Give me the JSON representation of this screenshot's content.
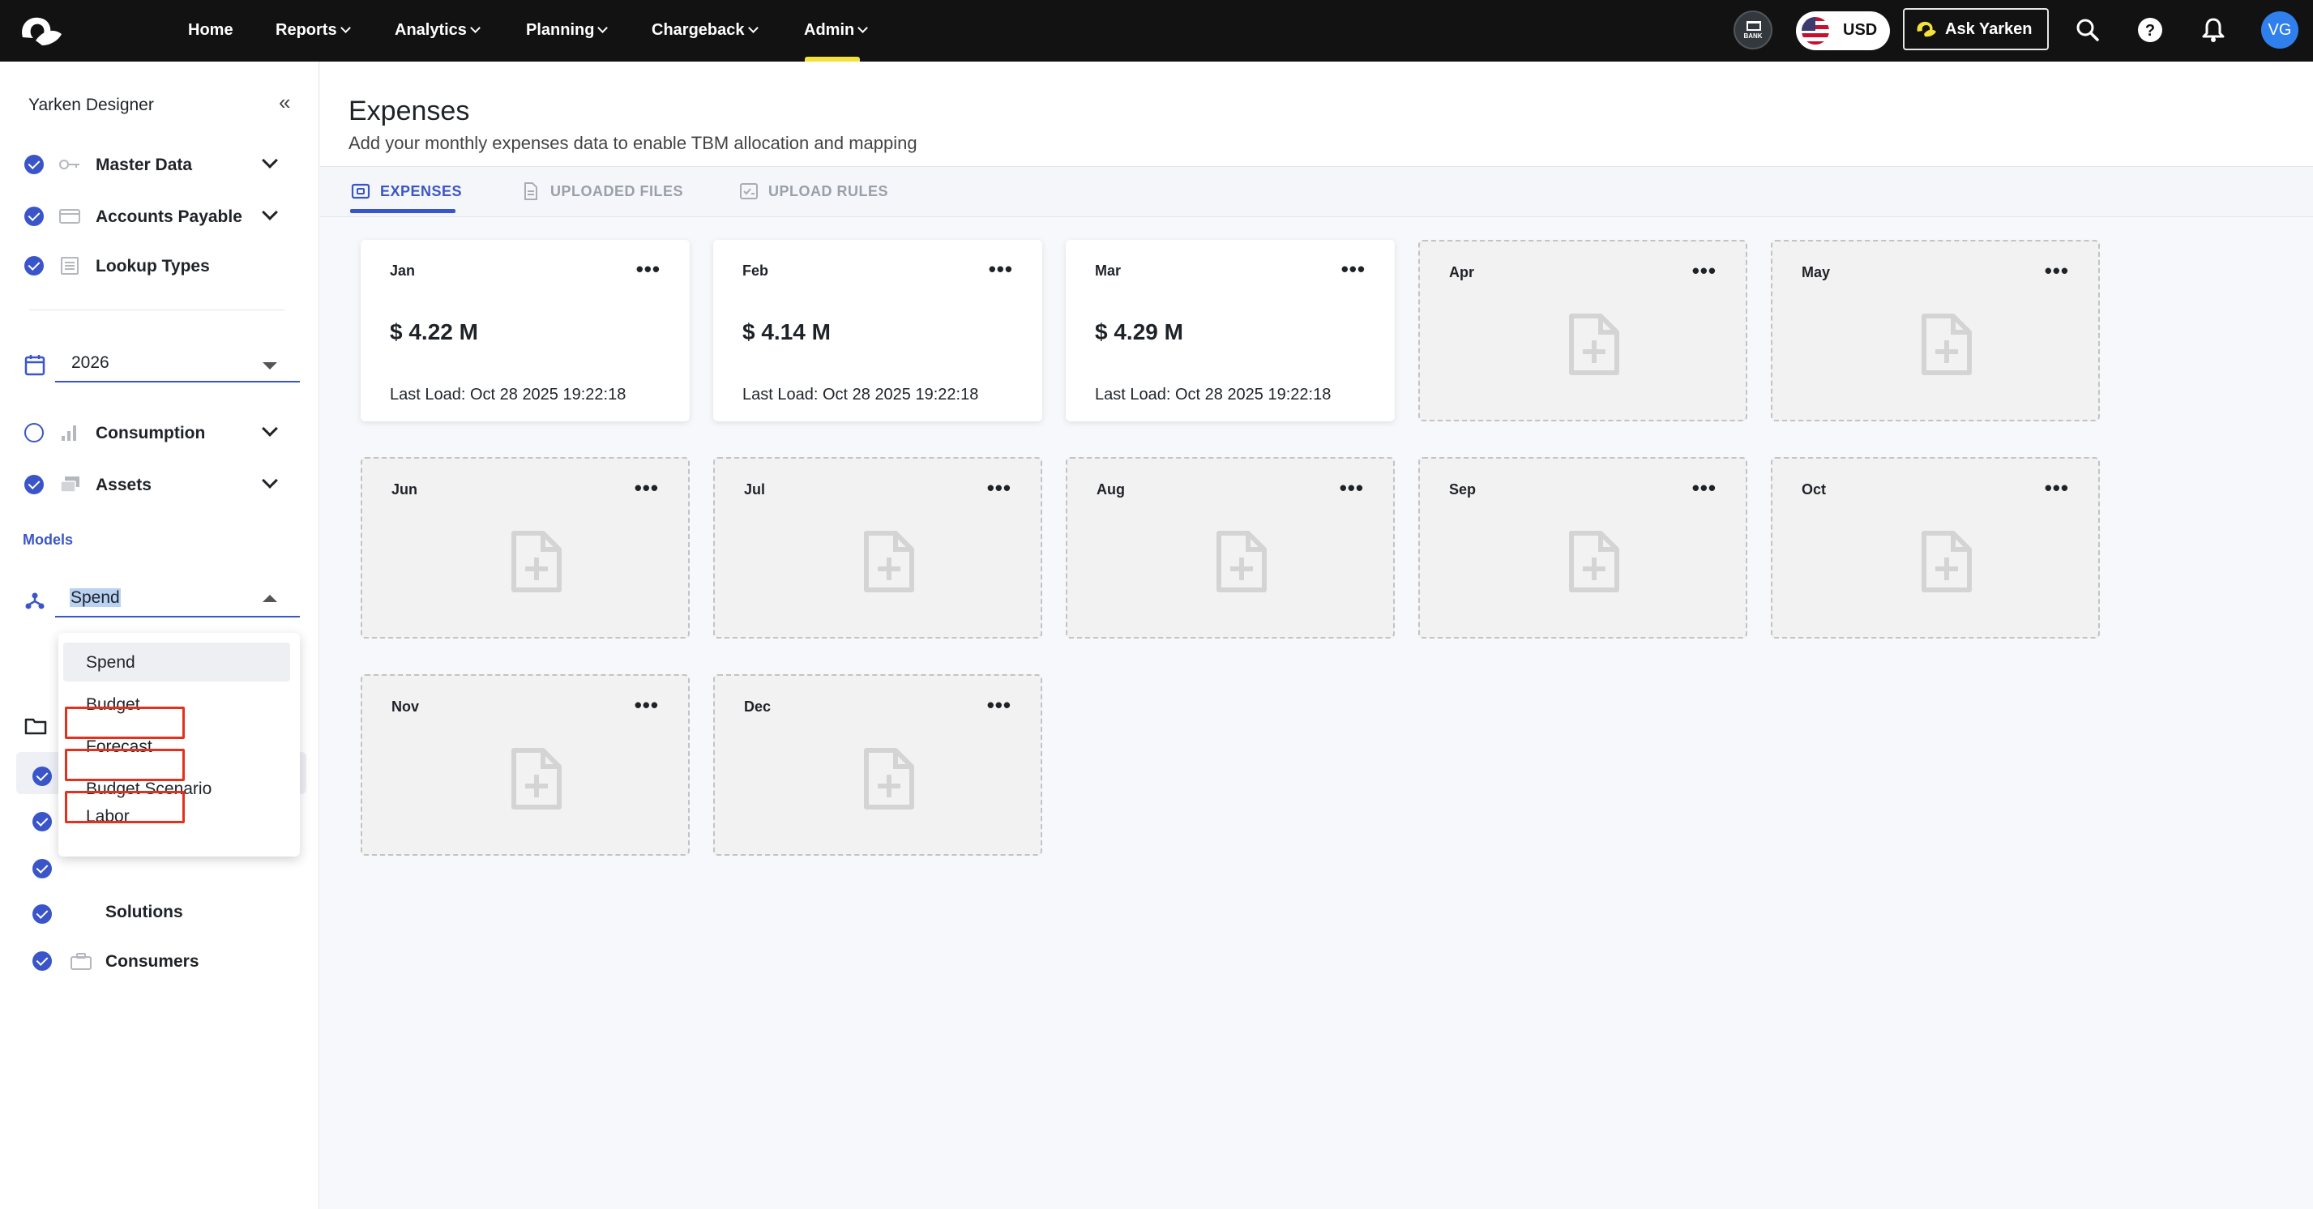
{
  "topnav": {
    "items": [
      {
        "label": "Home",
        "has_menu": false
      },
      {
        "label": "Reports",
        "has_menu": true
      },
      {
        "label": "Analytics",
        "has_menu": true
      },
      {
        "label": "Planning",
        "has_menu": true
      },
      {
        "label": "Chargeback",
        "has_menu": true
      },
      {
        "label": "Admin",
        "has_menu": true
      }
    ],
    "active": "Admin",
    "bank_label": "BANK",
    "currency": "USD",
    "ask_label": "Ask Yarken",
    "avatar_initials": "VG",
    "accent_color": "#f4e23b"
  },
  "sidebar": {
    "title": "Yarken Designer",
    "items_top": [
      {
        "label": "Master Data",
        "checked": true,
        "icon": "key-icon",
        "expandable": true
      },
      {
        "label": "Accounts Payable",
        "checked": true,
        "icon": "card-icon",
        "expandable": true
      },
      {
        "label": "Lookup Types",
        "checked": true,
        "icon": "list-icon",
        "expandable": false
      }
    ],
    "year": "2026",
    "items_mid": [
      {
        "label": "Consumption",
        "checked": false,
        "icon": "bar-chart-icon",
        "expandable": true
      },
      {
        "label": "Assets",
        "checked": true,
        "icon": "stack-icon",
        "expandable": true
      }
    ],
    "models_label": "Models",
    "model_selected": "Spend",
    "model_options": [
      "Spend",
      "Budget",
      "Forecast",
      "Budget Scenario",
      "Labor"
    ],
    "items_bottom": [
      {
        "label": "Consumers",
        "checked": true,
        "icon": "briefcase-icon"
      }
    ],
    "partial_label": "Solutions"
  },
  "page": {
    "title": "Expenses",
    "subtitle": "Add your monthly expenses data to enable TBM allocation and mapping",
    "tabs": [
      "EXPENSES",
      "UPLOADED FILES",
      "UPLOAD RULES"
    ],
    "active_tab": "EXPENSES"
  },
  "months": [
    {
      "month": "Jan",
      "amount": "$ 4.22 M",
      "last_load": "Last Load: Oct 28 2025 19:22:18"
    },
    {
      "month": "Feb",
      "amount": "$ 4.14 M",
      "last_load": "Last Load: Oct 28 2025 19:22:18"
    },
    {
      "month": "Mar",
      "amount": "$ 4.29 M",
      "last_load": "Last Load: Oct 28 2025 19:22:18"
    },
    {
      "month": "Apr"
    },
    {
      "month": "May"
    },
    {
      "month": "Jun"
    },
    {
      "month": "Jul"
    },
    {
      "month": "Aug"
    },
    {
      "month": "Sep"
    },
    {
      "month": "Oct"
    },
    {
      "month": "Nov"
    },
    {
      "month": "Dec"
    }
  ],
  "more_label": "•••",
  "colors": {
    "brand_blue": "#3a55c9",
    "highlight_red": "#e3311d"
  }
}
